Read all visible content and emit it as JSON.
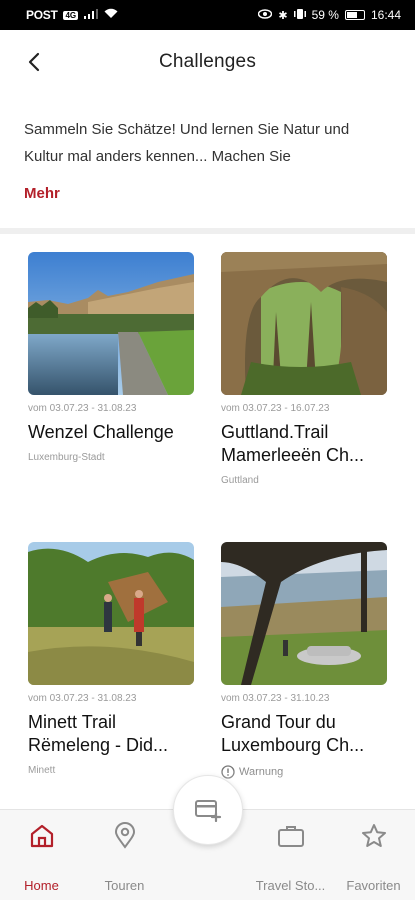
{
  "status_bar": {
    "carrier": "POST",
    "network": "4G",
    "battery": "59 %",
    "time": "16:44"
  },
  "header": {
    "title": "Challenges"
  },
  "intro": {
    "text": "Sammeln Sie Schätze! Und lernen Sie Natur und Kultur mal anders kennen... Machen Sie",
    "more": "Mehr"
  },
  "challenges": [
    {
      "dates": "vom 03.07.23 - 31.08.23",
      "name": "Wenzel Challenge",
      "location": "Luxemburg-Stadt"
    },
    {
      "dates": "vom 03.07.23 - 16.07.23",
      "name": "Guttland.Trail\nMamerleeën Ch...",
      "location": "Guttland"
    },
    {
      "dates": "vom 03.07.23 - 31.08.23",
      "name": "Minett Trail\nRëmeleng - Did...",
      "location": "Minett"
    },
    {
      "dates": "vom 03.07.23 - 31.10.23",
      "name": "Grand Tour du\nLuxembourg Ch...",
      "location": "Warnung"
    }
  ],
  "bottom_nav": [
    {
      "label": "Home",
      "icon": "home-icon",
      "active": true
    },
    {
      "label": "Touren",
      "icon": "map-pin-icon"
    },
    {
      "label": "Travel Sto...",
      "icon": "briefcase-icon"
    },
    {
      "label": "Favoriten",
      "icon": "star-icon"
    }
  ],
  "fab": {
    "icon": "add-card-icon"
  },
  "colors": {
    "accent": "#b3202a",
    "text": "#1a1a1a",
    "muted": "#9a9a9a"
  }
}
